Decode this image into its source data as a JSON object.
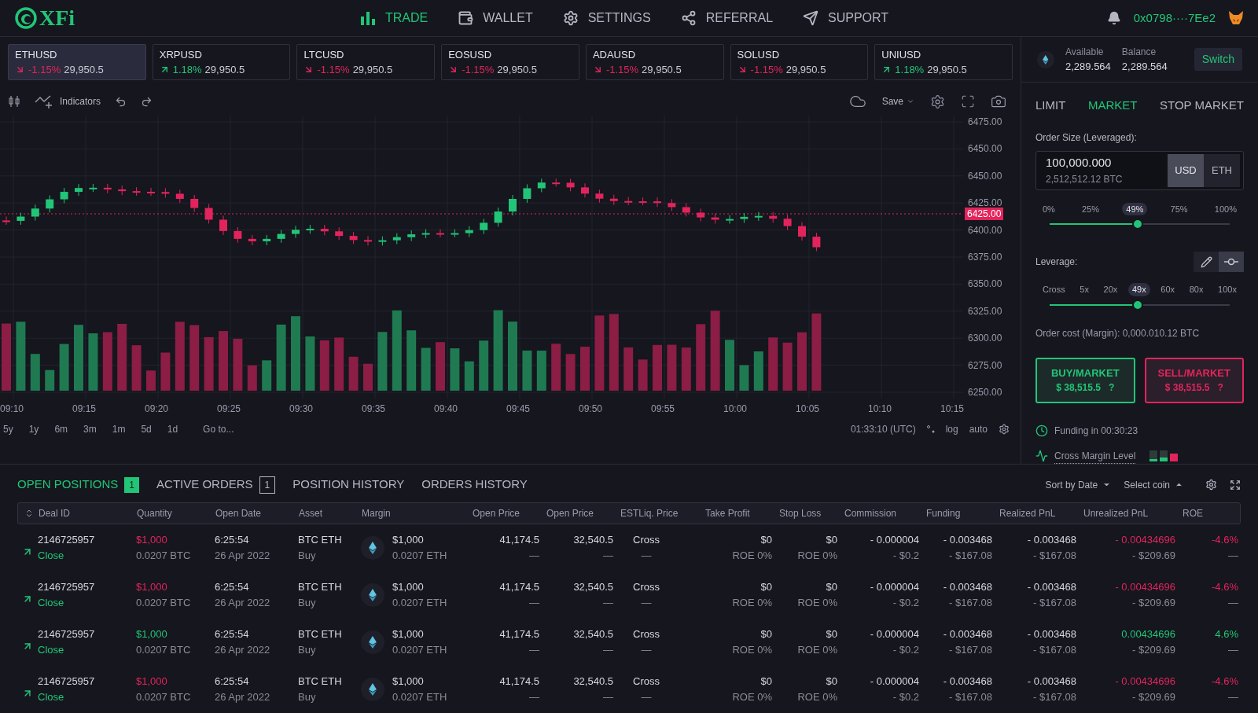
{
  "header": {
    "logo": "XFi",
    "nav": [
      {
        "label": "TRADE",
        "selected": true
      },
      {
        "label": "WALLET",
        "selected": false
      },
      {
        "label": "SETTINGS",
        "selected": false
      },
      {
        "label": "REFERRAL",
        "selected": false
      },
      {
        "label": "SUPPORT",
        "selected": false
      }
    ],
    "wallet_address": "0x0798····7Ee2"
  },
  "tickers": [
    {
      "symbol": "ETHUSD",
      "up": false,
      "change": "-1.15%",
      "price": "29,950.5",
      "selected": true
    },
    {
      "symbol": "XRPUSD",
      "up": true,
      "change": "1.18%",
      "price": "29,950.5",
      "selected": false
    },
    {
      "symbol": "LTCUSD",
      "up": false,
      "change": "-1.15%",
      "price": "29,950.5",
      "selected": false
    },
    {
      "symbol": "EOSUSD",
      "up": false,
      "change": "-1.15%",
      "price": "29,950.5",
      "selected": false
    },
    {
      "symbol": "ADAUSD",
      "up": false,
      "change": "-1.15%",
      "price": "29,950.5",
      "selected": false
    },
    {
      "symbol": "SOLUSD",
      "up": false,
      "change": "-1.15%",
      "price": "29,950.5",
      "selected": false
    },
    {
      "symbol": "UNIUSD",
      "up": true,
      "change": "1.18%",
      "price": "29,950.5",
      "selected": false
    }
  ],
  "chart": {
    "indicators": "Indicators",
    "save": "Save",
    "y_labels": [
      "6475.00",
      "6450.00",
      "6450.00",
      "6425.00",
      "6400.00",
      "6375.00",
      "6350.00",
      "6325.00",
      "6300.00",
      "6275.00",
      "6250.00"
    ],
    "price_tag": "6425.00",
    "x_labels": [
      "09:10",
      "09:15",
      "09:20",
      "09:25",
      "09:30",
      "09:35",
      "09:40",
      "09:45",
      "09:50",
      "09:55",
      "10:00",
      "10:05",
      "10:10",
      "10:15"
    ],
    "ranges": [
      "5y",
      "1y",
      "6m",
      "3m",
      "1m",
      "5d",
      "1d"
    ],
    "goto": "Go to...",
    "time": "01:33:10 (UTC)",
    "log": "log",
    "auto": "auto"
  },
  "order_panel": {
    "available_label": "Available",
    "available": "2,289.564",
    "balance_label": "Balance",
    "balance": "2,289.564",
    "switch": "Switch",
    "tabs": [
      {
        "label": "LIMIT",
        "selected": false
      },
      {
        "label": "MARKET",
        "selected": true
      },
      {
        "label": "STOP MARKET",
        "selected": false
      }
    ],
    "size_label": "Order Size (Leveraged):",
    "size_value": "100,000.000",
    "size_sub": "2,512,512.12 BTC",
    "units": [
      {
        "label": "USD",
        "selected": true
      },
      {
        "label": "ETH",
        "selected": false
      }
    ],
    "size_slider": {
      "level": 0.49,
      "labels": [
        {
          "text": "0%",
          "current": false
        },
        {
          "text": "25%",
          "current": false
        },
        {
          "text": "49%",
          "current": true
        },
        {
          "text": "75%",
          "current": false
        },
        {
          "text": "100%",
          "current": false
        }
      ]
    },
    "leverage_label": "Leverage:",
    "leverage_modes": [
      {
        "kind": "pencil",
        "selected": false
      },
      {
        "kind": "slider",
        "selected": true
      }
    ],
    "leverage_slider": {
      "level": 0.49,
      "labels": [
        {
          "text": "Cross",
          "current": false
        },
        {
          "text": "5x",
          "current": false
        },
        {
          "text": "20x",
          "current": false
        },
        {
          "text": "49x",
          "current": true
        },
        {
          "text": "60x",
          "current": false
        },
        {
          "text": "80x",
          "current": false
        },
        {
          "text": "100x",
          "current": false
        }
      ]
    },
    "order_cost": "Order cost (Margin): 0,000.010.12 BTC",
    "buy": {
      "label": "BUY/MARKET",
      "price": "$ 38,515.5",
      "hint": "?"
    },
    "sell": {
      "label": "SELL/MARKET",
      "price": "$ 38,515.5",
      "hint": "?"
    },
    "funding": "Funding in 00:30:23",
    "cross_margin": "Cross Margin Level"
  },
  "positions": {
    "tabs": [
      {
        "label": "OPEN POSITIONS",
        "count": "1",
        "selected": true
      },
      {
        "label": "ACTIVE ORDERS",
        "count": "1",
        "selected": false
      },
      {
        "label": "POSITION HISTORY",
        "selected": false
      },
      {
        "label": "ORDERS HISTORY",
        "selected": false
      }
    ],
    "sort": "Sort by Date",
    "coin": "Select coin",
    "columns": [
      {
        "label": "Deal ID",
        "kind": "id"
      },
      {
        "label": "Quantity",
        "kind": "toned"
      },
      {
        "label": "Open Date",
        "kind": "text"
      },
      {
        "label": "Asset",
        "kind": "text"
      },
      {
        "label": "Margin",
        "kind": "coin"
      },
      {
        "label": "Open Price",
        "kind": "number"
      },
      {
        "label": "Open Price",
        "kind": "number"
      },
      {
        "label": "ESTLiq. Price",
        "kind": "center"
      },
      {
        "label": "Take Profit",
        "kind": "number"
      },
      {
        "label": "Stop Loss",
        "kind": "number"
      },
      {
        "label": "Commission",
        "kind": "number"
      },
      {
        "label": "Funding",
        "kind": "number"
      },
      {
        "label": "Realized PnL",
        "kind": "number"
      },
      {
        "label": "Unrealized PnL",
        "kind": "toned_number"
      },
      {
        "label": "ROE",
        "kind": "toned_number"
      }
    ],
    "rows": [
      {
        "positive": false,
        "cells": [
          [
            "2146725957",
            "Close"
          ],
          [
            "$1,000",
            "0.0207 BTC"
          ],
          [
            "6:25:54",
            "26 Apr 2022"
          ],
          [
            "BTC ETH",
            "Buy"
          ],
          [
            "$1,000",
            "0.0207 ETH"
          ],
          [
            "41,174.5",
            "—"
          ],
          [
            "32,540.5",
            "—"
          ],
          [
            "Cross",
            "—"
          ],
          [
            "$0",
            "ROE 0%"
          ],
          [
            "$0",
            "ROE 0%"
          ],
          [
            "- 0.000004",
            "- $0.2"
          ],
          [
            "- 0.003468",
            "- $167.08"
          ],
          [
            "- 0.003468",
            "- $167.08"
          ],
          [
            "- 0.00434696",
            "- $209.69"
          ],
          [
            "-4.6%",
            "—"
          ]
        ]
      },
      {
        "positive": false,
        "cells": [
          [
            "2146725957",
            "Close"
          ],
          [
            "$1,000",
            "0.0207 BTC"
          ],
          [
            "6:25:54",
            "26 Apr 2022"
          ],
          [
            "BTC ETH",
            "Buy"
          ],
          [
            "$1,000",
            "0.0207 ETH"
          ],
          [
            "41,174.5",
            "—"
          ],
          [
            "32,540.5",
            "—"
          ],
          [
            "Cross",
            "—"
          ],
          [
            "$0",
            "ROE 0%"
          ],
          [
            "$0",
            "ROE 0%"
          ],
          [
            "- 0.000004",
            "- $0.2"
          ],
          [
            "- 0.003468",
            "- $167.08"
          ],
          [
            "- 0.003468",
            "- $167.08"
          ],
          [
            "- 0.00434696",
            "- $209.69"
          ],
          [
            "-4.6%",
            "—"
          ]
        ]
      },
      {
        "positive": true,
        "cells": [
          [
            "2146725957",
            "Close"
          ],
          [
            "$1,000",
            "0.0207 BTC"
          ],
          [
            "6:25:54",
            "26 Apr 2022"
          ],
          [
            "BTC ETH",
            "Buy"
          ],
          [
            "$1,000",
            "0.0207 ETH"
          ],
          [
            "41,174.5",
            "—"
          ],
          [
            "32,540.5",
            "—"
          ],
          [
            "Cross",
            "—"
          ],
          [
            "$0",
            "ROE 0%"
          ],
          [
            "$0",
            "ROE 0%"
          ],
          [
            "- 0.000004",
            "- $0.2"
          ],
          [
            "- 0.003468",
            "- $167.08"
          ],
          [
            "- 0.003468",
            "- $167.08"
          ],
          [
            "0.00434696",
            "- $209.69"
          ],
          [
            "4.6%",
            "—"
          ]
        ]
      },
      {
        "positive": false,
        "cells": [
          [
            "2146725957",
            "Close"
          ],
          [
            "$1,000",
            "0.0207 BTC"
          ],
          [
            "6:25:54",
            "26 Apr 2022"
          ],
          [
            "BTC ETH",
            "Buy"
          ],
          [
            "$1,000",
            "0.0207 ETH"
          ],
          [
            "41,174.5",
            "—"
          ],
          [
            "32,540.5",
            "—"
          ],
          [
            "Cross",
            "—"
          ],
          [
            "$0",
            "ROE 0%"
          ],
          [
            "$0",
            "ROE 0%"
          ],
          [
            "- 0.000004",
            "- $0.2"
          ],
          [
            "- 0.003468",
            "- $167.08"
          ],
          [
            "- 0.003468",
            "- $167.08"
          ],
          [
            "- 0.00434696",
            "- $209.69"
          ],
          [
            "-4.6%",
            "—"
          ]
        ]
      }
    ]
  }
}
